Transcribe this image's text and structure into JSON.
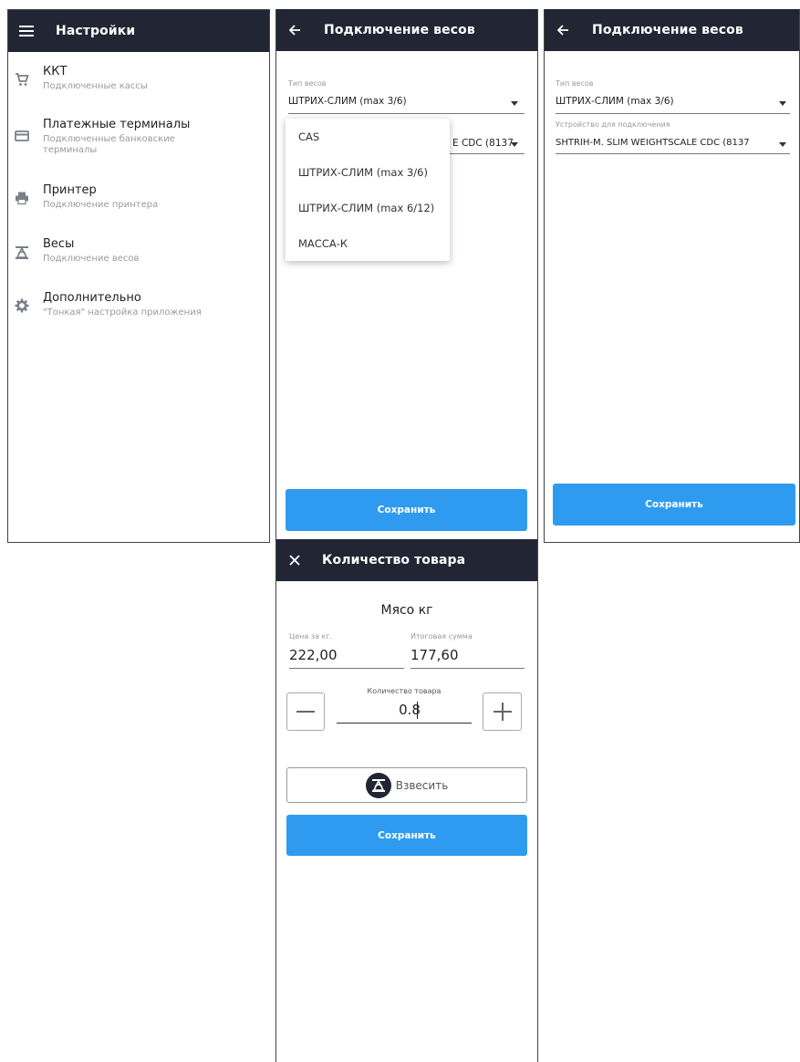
{
  "settings": {
    "title": "Настройки",
    "items": [
      {
        "title": "ККТ",
        "subtitle": "Подключенные кассы",
        "icon": "cart-icon"
      },
      {
        "title": "Платежные терминалы",
        "subtitle": "Подключенные банковские терминалы",
        "icon": "card-icon"
      },
      {
        "title": "Принтер",
        "subtitle": "Подключение принтера",
        "icon": "printer-icon"
      },
      {
        "title": "Весы",
        "subtitle": "Подключение весов",
        "icon": "scale-icon"
      },
      {
        "title": "Дополнительно",
        "subtitle": "\"Тонкая\" настройка приложения",
        "icon": "gear-icon"
      }
    ]
  },
  "scale_dropdown_screen": {
    "title": "Подключение весов",
    "scale_type_label": "Тип весов",
    "scale_type_value": "ШТРИХ-СЛИМ (max 3/6)",
    "device_value_partial": "E CDC (8137",
    "options": [
      "CAS",
      "ШТРИХ-СЛИМ (max 3/6)",
      "ШТРИХ-СЛИМ (max 6/12)",
      "МАССА-К"
    ],
    "save_label": "Сохранить"
  },
  "scale_screen": {
    "title": "Подключение весов",
    "scale_type_label": "Тип весов",
    "scale_type_value": "ШТРИХ-СЛИМ (max 3/6)",
    "device_label": "Устройство для подключения",
    "device_value": "SHTRIH-M. SLIM WEIGHTSCALE CDC (8137",
    "save_label": "Сохранить"
  },
  "quantity_screen": {
    "title": "Количество товара",
    "product_name": "Мясо кг",
    "price_label": "Цена за кг.",
    "price_value": "222,00",
    "total_label": "Итоговая сумма",
    "total_value": "177,60",
    "quantity_label": "Количество товара",
    "quantity_value": "0.8",
    "weigh_label": "Взвесить",
    "save_label": "Сохранить"
  },
  "colors": {
    "appbar": "#222634",
    "primary": "#2f9bf0",
    "icon": "#7a7f88"
  }
}
